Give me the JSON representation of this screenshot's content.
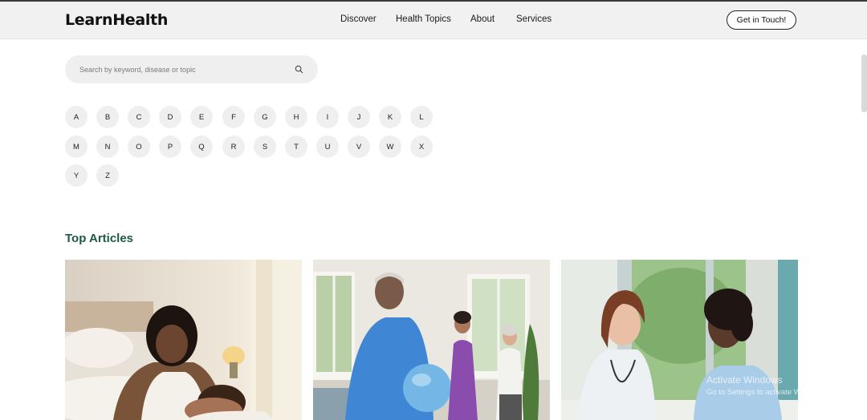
{
  "header": {
    "logo": "LearnHealth",
    "nav": [
      "Discover",
      "Health Topics",
      "About",
      "Services"
    ],
    "cta": "Get in Touch!"
  },
  "search": {
    "placeholder": "Search by keyword, disease or topic",
    "icon": "search-icon"
  },
  "alphabet": [
    "A",
    "B",
    "C",
    "D",
    "E",
    "F",
    "G",
    "H",
    "I",
    "J",
    "K",
    "L",
    "M",
    "N",
    "O",
    "P",
    "Q",
    "R",
    "S",
    "T",
    "U",
    "V",
    "W",
    "X",
    "Y",
    "Z"
  ],
  "top_articles": {
    "title": "Top Articles",
    "cards": [
      {
        "image": "mother-with-baby-image"
      },
      {
        "image": "exercise-class-image"
      },
      {
        "image": "doctor-with-patient-image"
      }
    ]
  },
  "watermark": {
    "line1": "Activate Windows",
    "line2": "Go to Settings to activate Windows."
  },
  "colors": {
    "accent_green": "#1d5a43",
    "header_bg": "#f1f1f1",
    "chip_bg": "#efefef"
  }
}
